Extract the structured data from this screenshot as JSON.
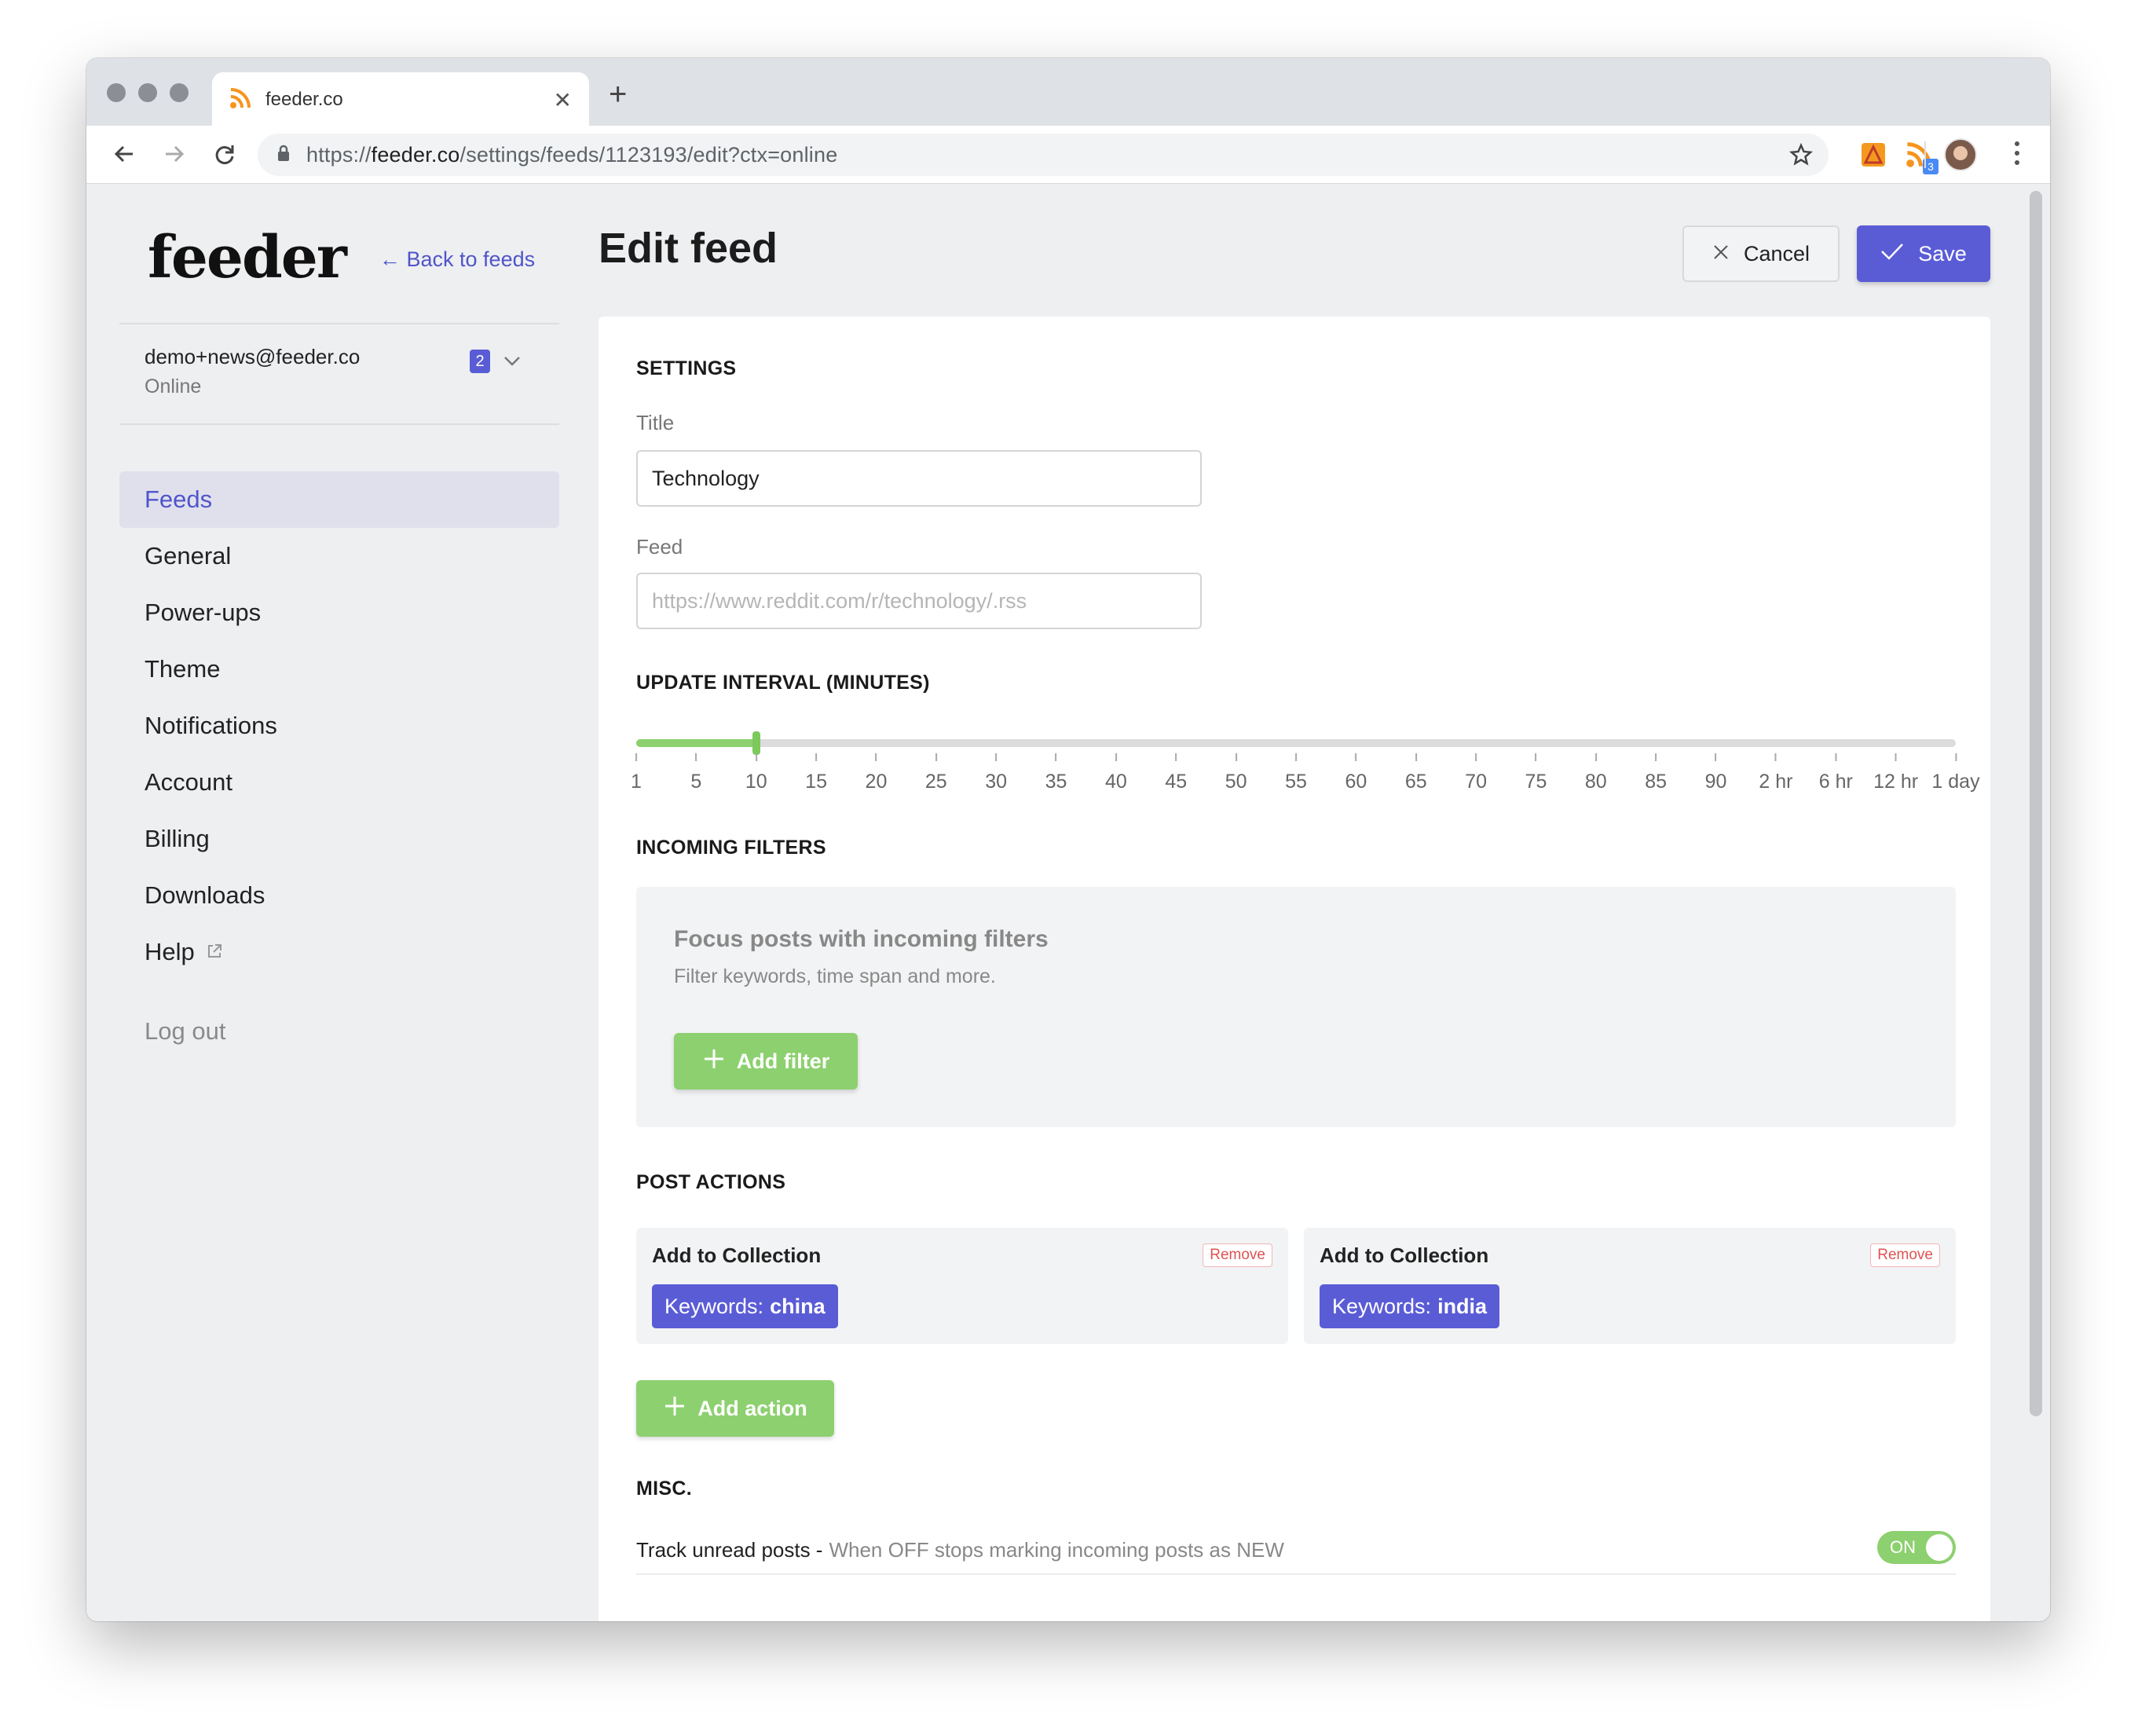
{
  "browser": {
    "tab_title": "feeder.co",
    "url_prefix": "https://",
    "url_host": "feeder.co",
    "url_path": "/settings/feeds/1123193/edit?ctx=online",
    "extension_badge": "3"
  },
  "sidebar": {
    "logo": "feeder",
    "back_link": "← Back to feeds",
    "account_email": "demo+news@feeder.co",
    "account_status": "Online",
    "account_badge": "2",
    "nav": [
      {
        "label": "Feeds",
        "active": true
      },
      {
        "label": "General"
      },
      {
        "label": "Power-ups"
      },
      {
        "label": "Theme"
      },
      {
        "label": "Notifications"
      },
      {
        "label": "Account"
      },
      {
        "label": "Billing"
      },
      {
        "label": "Downloads"
      },
      {
        "label": "Help"
      }
    ],
    "logout": "Log out"
  },
  "header": {
    "title": "Edit feed",
    "cancel_label": "Cancel",
    "save_label": "Save"
  },
  "settings": {
    "heading": "SETTINGS",
    "title_label": "Title",
    "title_value": "Technology",
    "feed_label": "Feed",
    "feed_placeholder": "https://www.reddit.com/r/technology/.rss"
  },
  "interval": {
    "heading": "UPDATE INTERVAL (MINUTES)",
    "ticks": [
      "1",
      "5",
      "10",
      "15",
      "20",
      "25",
      "30",
      "35",
      "40",
      "45",
      "50",
      "55",
      "60",
      "65",
      "70",
      "75",
      "80",
      "85",
      "90",
      "2 hr",
      "6 hr",
      "12 hr",
      "1 day"
    ],
    "selected_index": 2
  },
  "filters": {
    "heading": "INCOMING FILTERS",
    "title": "Focus posts with incoming filters",
    "subtitle": "Filter keywords, time span and more.",
    "add_label": "Add filter"
  },
  "actions": {
    "heading": "POST ACTIONS",
    "items": [
      {
        "title": "Add to Collection",
        "remove": "Remove",
        "kw_prefix": "Keywords:",
        "kw_value": "china"
      },
      {
        "title": "Add to Collection",
        "remove": "Remove",
        "kw_prefix": "Keywords:",
        "kw_value": "india"
      }
    ],
    "add_label": "Add action"
  },
  "misc": {
    "heading": "MISC.",
    "track_label": "Track unread posts -",
    "track_desc": "When OFF stops marking incoming posts as NEW",
    "toggle_label": "ON"
  },
  "colors": {
    "accent": "#5a5cd6",
    "green": "#8dd06f",
    "remove_red": "#e05252"
  }
}
